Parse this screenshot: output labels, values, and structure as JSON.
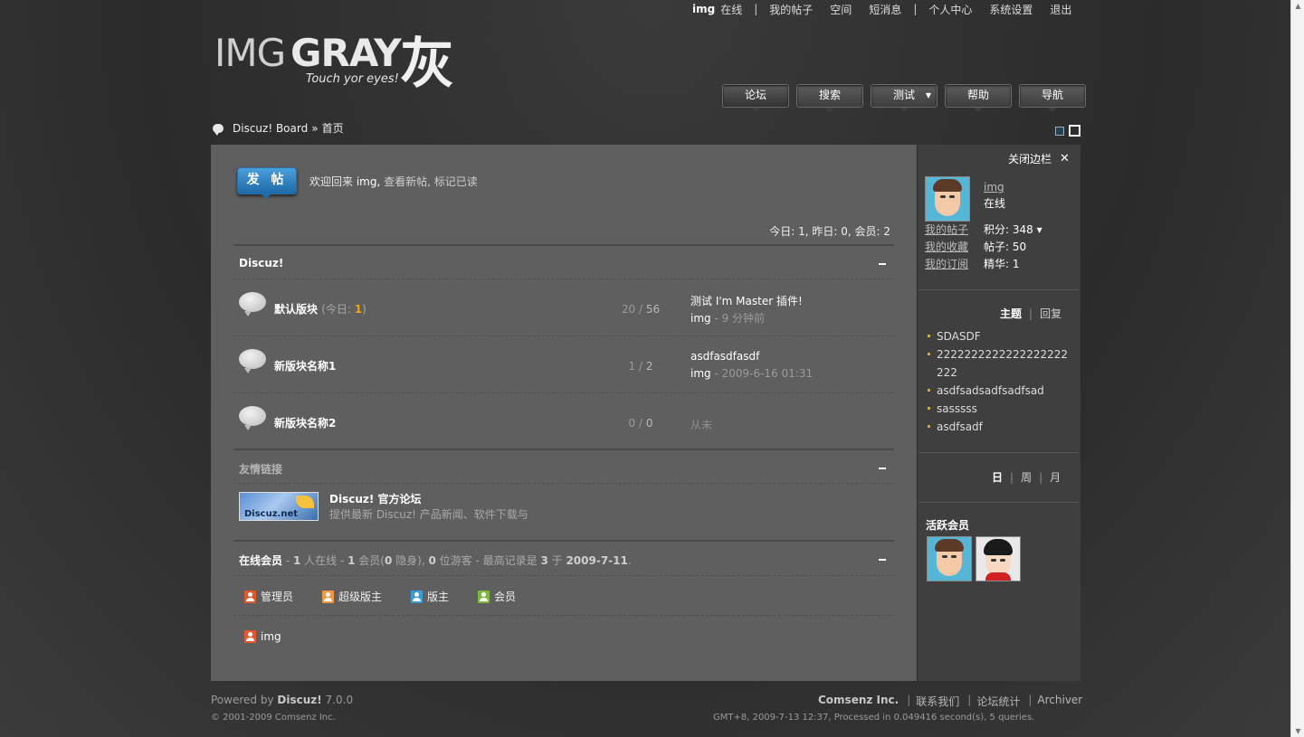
{
  "toplinks": {
    "username": "img",
    "status": "在线",
    "sep": "|",
    "my_posts": "我的帖子",
    "space": "空间",
    "messages": "短消息",
    "profile": "个人中心",
    "settings": "系统设置",
    "logout": "退出"
  },
  "logo": {
    "part1": "IMG",
    "part2": "GRAY",
    "char": "灰",
    "tagline": "Touch yor eyes!"
  },
  "nav": {
    "forum": "论坛",
    "search": "搜索",
    "test": "测试",
    "help": "帮助",
    "guide": "导航"
  },
  "breadcrumb": {
    "board": "Discuz! Board",
    "sep": "»",
    "home": "首页"
  },
  "post_button": "发 帖",
  "welcome": {
    "prefix": "欢迎回来",
    "user": "img,",
    "new_posts": "查看新帖,",
    "mark_read": "标记已读"
  },
  "stats": "今日: 1, 昨日: 0, 会员: 2",
  "category": {
    "title": "Discuz!"
  },
  "forums": [
    {
      "name": "默认版块",
      "today_prefix": "(今日: ",
      "today_num": "1",
      "today_suffix": ")",
      "threads": "20",
      "slash": " / ",
      "posts": "56",
      "last_title": "测试 I'm Master 插件!",
      "last_user": "img",
      "last_time": " - 9 分钟前"
    },
    {
      "name": "新版块名称1",
      "threads": "1",
      "slash": " / ",
      "posts": "2",
      "last_title": "asdfasdfasdf",
      "last_user": "img",
      "last_time": " - 2009-6-16 01:31"
    },
    {
      "name": "新版块名称2",
      "threads": "0",
      "slash": " / ",
      "posts": "0",
      "never": "从未"
    }
  ],
  "links": {
    "title": "友情链接",
    "logo_text": "Discuz.net",
    "name": "Discuz! 官方论坛",
    "desc": "提供最新 Discuz! 产品新闻、软件下载与"
  },
  "online": {
    "title": "在线会员",
    "t1": " - ",
    "total": "1",
    "t2": " 人在线 - ",
    "members": "1",
    "t3": " 会员(",
    "hidden": "0",
    "t4": " 隐身), ",
    "guests": "0",
    "t5": " 位游客 - 最高记录是 ",
    "record": "3",
    "t6": " 于 ",
    "record_date": "2009-7-11",
    "t7": ".",
    "legend": {
      "admin": "管理员",
      "super_mod": "超级版主",
      "mod": "版主",
      "member": "会员"
    },
    "user": "img"
  },
  "sidebar": {
    "close": "关闭边栏",
    "close_x": "✕",
    "username": "img",
    "status": "在线",
    "links": {
      "my_posts": "我的帖子",
      "favorites": "我的收藏",
      "subscriptions": "我的订阅"
    },
    "credits": "积分: 348",
    "credits_caret": "▾",
    "posts": "帖子: 50",
    "digest": "精华: 1",
    "tabs": {
      "threads": "主题",
      "sep": "|",
      "replies": "回复"
    },
    "threads": [
      "SDASDF",
      "2222222222222222222222",
      "asdfsadsadfsadfsad",
      "sasssss",
      "asdfsadf"
    ],
    "period": {
      "day": "日",
      "week": "周",
      "month": "月",
      "sep": "|"
    },
    "active_title": "活跃会员"
  },
  "footer": {
    "powered": "Powered by",
    "product": "Discuz!",
    "version": " 7.0.0",
    "copyright": "© 2001-2009 Comsenz Inc.",
    "company": "Comsenz Inc.",
    "sep": "|",
    "contact": "联系我们",
    "stats": "论坛统计",
    "archiver": "Archiver",
    "runtime": "GMT+8, 2009-7-13 12:37, Processed in 0.049416 second(s), 5 queries."
  },
  "colors": {
    "accent_orange": "#f5a300",
    "post_button_blue": "#1d6aa8",
    "panel": "#5f5f5f",
    "sidebar": "#3f3f3f"
  }
}
